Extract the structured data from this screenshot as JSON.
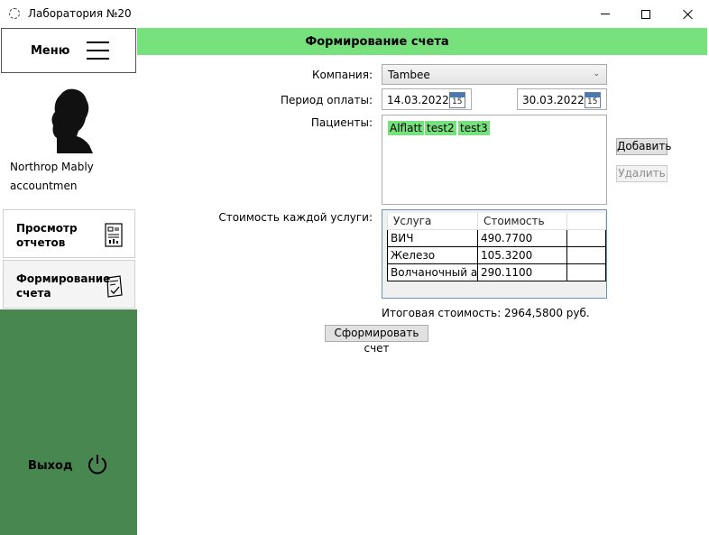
{
  "window": {
    "title": "Лаборатория №20"
  },
  "sidebar": {
    "menu_label": "Меню",
    "user_name": "Northrop Mably",
    "user_role": "accountmen",
    "nav": [
      {
        "label": "Просмотр отчетов",
        "icon": "report-icon"
      },
      {
        "label": "Формирование счета",
        "icon": "invoice-icon"
      }
    ],
    "logout_label": "Выход",
    "accent_color": "#48874f"
  },
  "header": {
    "title": "Формирование счета",
    "color": "#77e17d"
  },
  "form": {
    "company_label": "Компания:",
    "company_value": "Tambee",
    "period_label": "Период оплаты:",
    "period_start": "14.03.2022",
    "period_end": "30.03.2022",
    "calendar_day": "15",
    "patients_label": "Пациенты:",
    "patients": [
      "Alflatt",
      "test2",
      "test3"
    ],
    "add_button": "Добавить",
    "remove_button": "Удалить",
    "cost_label": "Стоимость каждой услуги:",
    "grid": {
      "headers": [
        "Услуга",
        "Стоимость",
        ""
      ],
      "rows": [
        [
          "ВИЧ",
          "490.7700",
          ""
        ],
        [
          "Железо",
          "105.3200",
          ""
        ],
        [
          "Волчаночный ан",
          "290.1100",
          ""
        ]
      ]
    },
    "total_text": "Итоговая стоимость: 2964,5800 руб.",
    "generate_button": "Сформировать счет"
  }
}
